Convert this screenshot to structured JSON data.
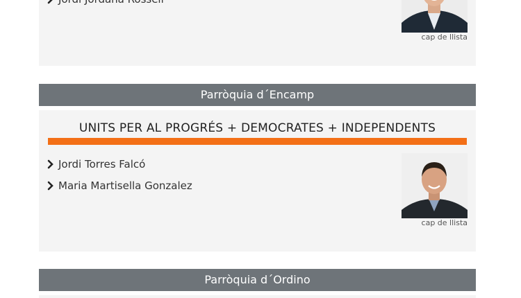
{
  "sections": [
    {
      "candidates": [
        "Jordi Jordana Rossell"
      ],
      "caption": "cap de llista"
    },
    {
      "header": "Parròquia d´Encamp",
      "party": "UNITS PER AL PROGRÉS + DEMOCRATES + INDEPENDENTS",
      "candidates": [
        "Jordi Torres Falcó",
        "Maria Martisella Gonzalez"
      ],
      "caption": "cap de llista",
      "accent": "#f36f16"
    },
    {
      "header": "Parròquia d´Ordino"
    }
  ],
  "colors": {
    "header_bg": "#6e7479",
    "card_bg": "#f4f4f4",
    "accent": "#f36f16"
  },
  "icons": {
    "bullet": "chevron-right-icon"
  }
}
